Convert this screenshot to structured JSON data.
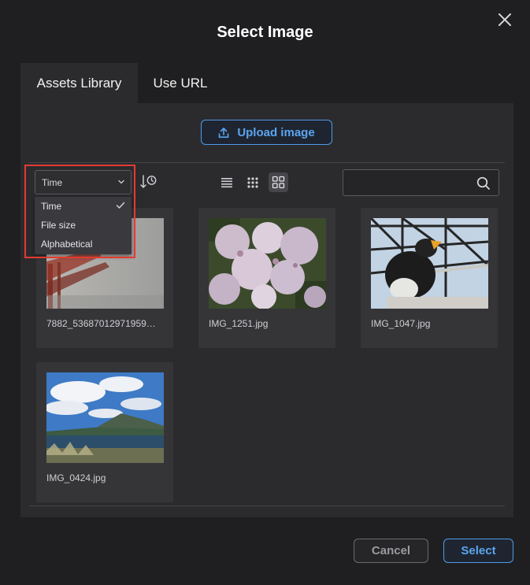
{
  "dialog": {
    "title": "Select Image",
    "close_icon": "close-icon"
  },
  "tabs": [
    {
      "label": "Assets Library",
      "active": true
    },
    {
      "label": "Use URL",
      "active": false
    }
  ],
  "toolbar": {
    "upload_label": "Upload image",
    "upload_icon": "upload-icon",
    "sort_selected": "Time",
    "sort_order_icon": "sort-order-icon",
    "view_modes": [
      {
        "name": "list-view-icon",
        "active": false
      },
      {
        "name": "small-grid-view-icon",
        "active": false
      },
      {
        "name": "large-grid-view-icon",
        "active": true
      }
    ],
    "search_placeholder": "",
    "search_icon": "search-icon"
  },
  "sort_dropdown": {
    "options": [
      "Time",
      "File size",
      "Alphabetical"
    ],
    "selected": "Time"
  },
  "assets": [
    {
      "filename": "7882_53687012971959…",
      "subject": "bridge in fog"
    },
    {
      "filename": "IMG_1251.jpg",
      "subject": "lilac flowers"
    },
    {
      "filename": "IMG_1047.jpg",
      "subject": "eagle on structure"
    },
    {
      "filename": "IMG_0424.jpg",
      "subject": "coastal mountain landscape"
    }
  ],
  "footer": {
    "cancel_label": "Cancel",
    "select_label": "Select"
  },
  "colors": {
    "accent": "#4e9be8",
    "highlight": "#e33b2e",
    "background": "#1f1f21",
    "panel": "#2b2b2e"
  }
}
